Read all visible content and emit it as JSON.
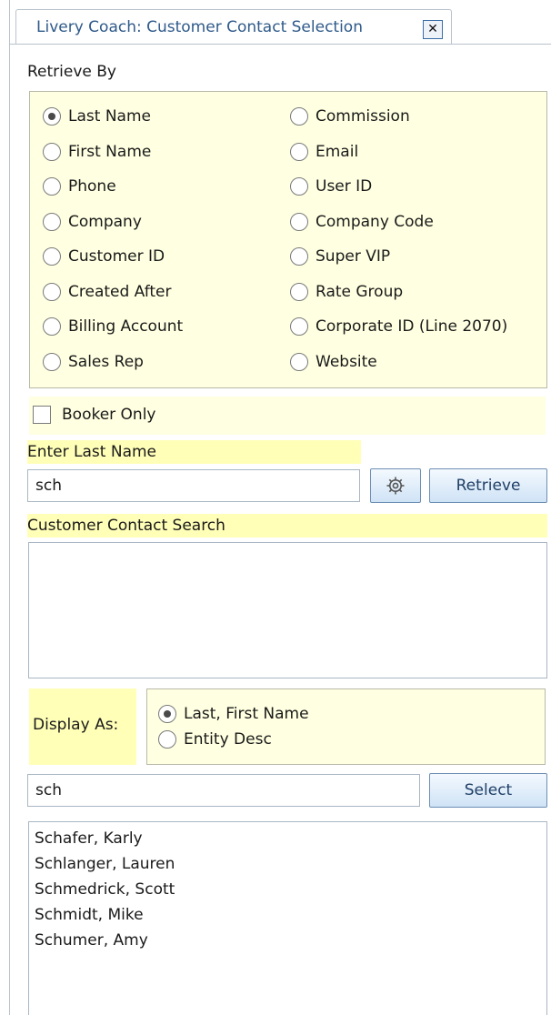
{
  "tab": {
    "title": "Livery Coach: Customer Contact Selection",
    "close_glyph": "✕"
  },
  "retrieve_by": {
    "label": "Retrieve By",
    "options_left": [
      "Last Name",
      "First Name",
      "Phone",
      "Company",
      "Customer ID",
      "Created After",
      "Billing Account",
      "Sales Rep"
    ],
    "options_right": [
      "Commission",
      "Email",
      "User ID",
      "Company Code",
      "Super VIP",
      "Rate Group",
      "Corporate ID (Line 2070)",
      "Website"
    ],
    "selected": "Last Name"
  },
  "booker_only": {
    "label": "Booker Only",
    "checked": false
  },
  "search": {
    "label": "Enter Last Name",
    "value": "sch",
    "settings_icon": "gear-icon",
    "retrieve_label": "Retrieve"
  },
  "customer_contact_search": {
    "label": "Customer Contact Search",
    "items": []
  },
  "display_as": {
    "label": "Display As:",
    "options": [
      "Last, First Name",
      "Entity Desc"
    ],
    "selected": "Last, First Name"
  },
  "filter": {
    "value": "sch",
    "select_label": "Select"
  },
  "results": [
    "Schafer, Karly",
    "Schlanger, Lauren",
    "Schmedrick, Scott",
    "Schmidt, Mike",
    "Schumer, Amy"
  ]
}
